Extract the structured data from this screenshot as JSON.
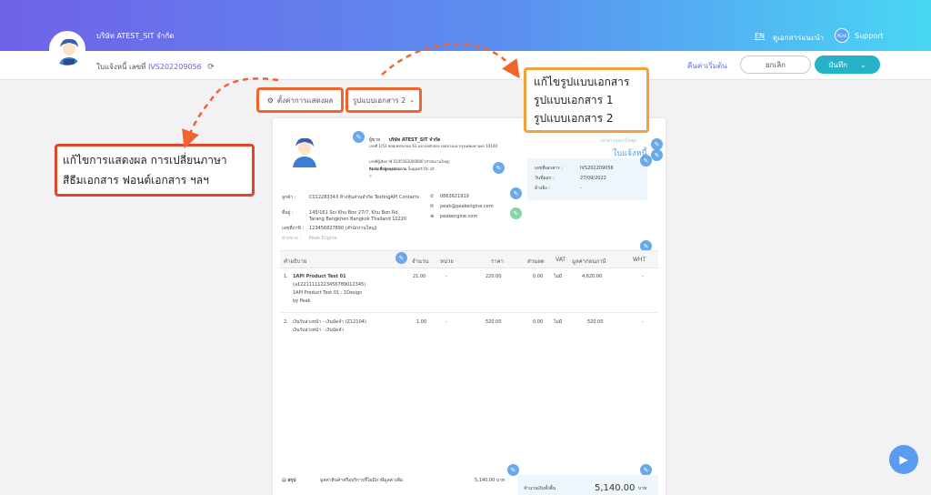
{
  "header": {
    "company_name": "บริษัท ATEST_SIT จำกัด",
    "lang": "EN",
    "guide": "ดูเอกสารแนะนำ",
    "support_circle_text": "PEAK",
    "support": "Support"
  },
  "subbar": {
    "doc_label": "ใบแจ้งหนี้ เลขที่",
    "doc_number": "IVS202209056",
    "reset": "คืนค่าเริ่มต้น",
    "cancel": "ยกเลิก",
    "save": "บันทึก"
  },
  "controls": {
    "display_settings": "ตั้งค่าการแสดงผล",
    "template_select": "รูปแบบเอกสาร 2"
  },
  "callouts": {
    "left_line1": "แก้ไขการแสดงผล การเปลี่ยนภาษา",
    "left_line2": "สีธีมเอกสาร  ฟอนต์เอกสาร ฯลฯ",
    "right_line1": "แก้ไขรูปแบบเอกสาร",
    "right_line2": "รูปแบบเอกสาร 1",
    "right_line3": "รูปแบบเอกสาร 2"
  },
  "document": {
    "issuer_label": "ผู้ขาย",
    "issuer_name": "บริษัท ATEST_SIT จำกัด",
    "issuer_address": "เลขที่ 1/53 ซอยเพชรเกษม 63 แขวงหลักสอง เขตบางแค กรุงเทพมหานคร 10160",
    "issuer_tax": "เลขที่ผู้เสียภาษี 0105561000000 (สำนักงานใหญ่)",
    "contact_label": "ติดต่อเพื่อพูดคุยสอบถาม",
    "contact_value": "Support On sit",
    "doc_type_label": "เอกสารออกเป็นชุด",
    "doc_type": "ใบแจ้งหนี้",
    "meta": [
      {
        "label": "เลขที่เอกสาร :",
        "value": "IVS202209056"
      },
      {
        "label": "วันที่ออก :",
        "value": "27/09/2022"
      },
      {
        "label": "อ้างอิง :",
        "value": "-"
      }
    ],
    "customer_label": "ลูกค้า :",
    "customer_name": "C012283343 ห้างหุ้นส่วนจำกัด TestingAPI Contacts",
    "address_label": "ที่อยู่ :",
    "address_line1": "145/161 Soi Khu Bon 27/7, Khu Bon Rd.",
    "address_line2": "Tarang Bangkhen Bangkok Thailand 10220",
    "taxid_label": "เลขที่ภาษี :",
    "taxid_value": "123456827890 (สำนักงานใหญ่)",
    "sales_label": "ฝ่ายขาย :",
    "sales_value": "Peak Engine",
    "phone": "0863621919",
    "email": "peak@peakengine.com",
    "website": "peakengine.com",
    "columns": [
      "คำอธิบาย",
      "จำนวน",
      "หน่วย",
      "ราคา",
      "ส่วนลด",
      "VAT",
      "มูลค่าก่อนภาษี",
      "WHT"
    ],
    "rows": [
      {
        "no": "1.",
        "name": "1API Product Test 01",
        "desc1": "(a12211111223456789012345)",
        "desc2": "1API Product Test 01 : 1Design",
        "desc3": "by Peak",
        "qty": "21.00",
        "unit": "-",
        "price": "220.00",
        "discount": "0.00",
        "vat": "ไม่มี",
        "amount": "4,620.00",
        "wht": "-"
      },
      {
        "no": "2.",
        "name": "เงินรับล่วงหน้า - เงินมัดจำ",
        "code": "(Z12104)",
        "desc1": "เงินรับล่วงหน้า - เงินมัดจำ",
        "qty": "1.00",
        "unit": "-",
        "price": "520.00",
        "discount": "0.00",
        "vat": "ไม่มี",
        "amount": "520.00",
        "wht": "-"
      }
    ],
    "summary_label": "สรุป",
    "summary_desc": "มูลค่าสินค้าหรือบริการที่ไม่มีภาษีมูลค่าเพิ่ม",
    "summary_value": "5,140.00 บาท",
    "total_label": "จำนวนเงินทั้งสิ้น",
    "total_value": "5,140.00",
    "total_unit": "บาท"
  }
}
